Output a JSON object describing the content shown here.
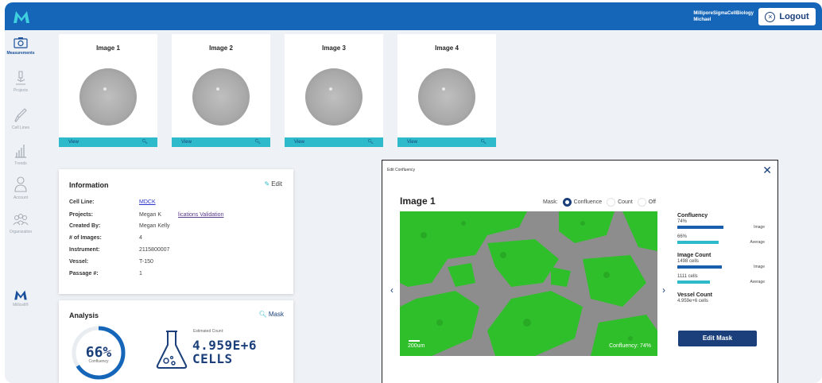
{
  "topbar": {
    "logo_icon": "m-logo-icon",
    "account_org": "MilliporeSigmaCellBiology",
    "account_user": "Michael",
    "logout_label": "Logout"
  },
  "sidebar": {
    "items": [
      {
        "label": "Measurements",
        "icon": "camera-icon",
        "active": true
      },
      {
        "label": "Projects",
        "icon": "microscope-icon",
        "active": false
      },
      {
        "label": "Cell Lines",
        "icon": "pipette-icon",
        "active": false
      },
      {
        "label": "Trends",
        "icon": "bar-chart-icon",
        "active": false
      },
      {
        "label": "Account",
        "icon": "user-icon",
        "active": false
      },
      {
        "label": "Organization",
        "icon": "group-icon",
        "active": false
      },
      {
        "label": "Millicell®",
        "icon": "m-logo-icon",
        "active": false
      }
    ]
  },
  "images": [
    {
      "title": "Image 1",
      "view": "View"
    },
    {
      "title": "Image 2",
      "view": "View"
    },
    {
      "title": "Image 3",
      "view": "View"
    },
    {
      "title": "Image 4",
      "view": "View"
    }
  ],
  "info": {
    "title": "Information",
    "edit": "Edit",
    "rows": [
      {
        "key": "Cell Line:",
        "value": "MDCK"
      },
      {
        "key": "Projects:",
        "value": "Megan K"
      },
      {
        "key": "Created By:",
        "value": "Megan Kelly"
      },
      {
        "key": "# of Images:",
        "value": "4"
      },
      {
        "key": "Instrument:",
        "value": "2115800007"
      },
      {
        "key": "Vessel:",
        "value": "T-150"
      },
      {
        "key": "Passage #:",
        "value": "1"
      }
    ],
    "projects_extra": "lications Validation"
  },
  "analysis": {
    "title": "Analysis",
    "mask": "Mask",
    "confluency_value": "66%",
    "confluency_label": "Confluency",
    "confluency_fraction": 0.66,
    "estimated_label": "Estimated Count:",
    "estimated_value": "4.959E+6",
    "estimated_unit": "CELLS"
  },
  "modal": {
    "title": "Edit Confluency",
    "heading": "Image 1",
    "mask_label": "Mask:",
    "mask_options": [
      {
        "label": "Confluence",
        "selected": true
      },
      {
        "label": "Count",
        "selected": false
      },
      {
        "label": "Off",
        "selected": false
      }
    ],
    "scale_label": "200um",
    "overlay_confluency": "Confluency:  74%",
    "stats": {
      "confluency_title": "Confluency",
      "confluency_image": "74%",
      "confluency_image_fraction": 0.74,
      "confluency_image_label": "Image",
      "confluency_avg": "66%",
      "confluency_avg_fraction": 0.66,
      "confluency_avg_label": "Average",
      "count_title": "Image Count",
      "count_image": "1498 cells",
      "count_image_fraction": 0.72,
      "count_image_label": "Image",
      "count_avg": "1111 cells",
      "count_avg_fraction": 0.53,
      "count_avg_label": "Average",
      "vessel_title": "Vessel Count",
      "vessel_value": "4.959e+6 cells"
    },
    "edit_mask": "Edit Mask"
  },
  "colors": {
    "brand_blue": "#1566b8",
    "navy": "#1a3f7a",
    "teal": "#2ebacb",
    "mask_green": "#2fbf2b"
  }
}
